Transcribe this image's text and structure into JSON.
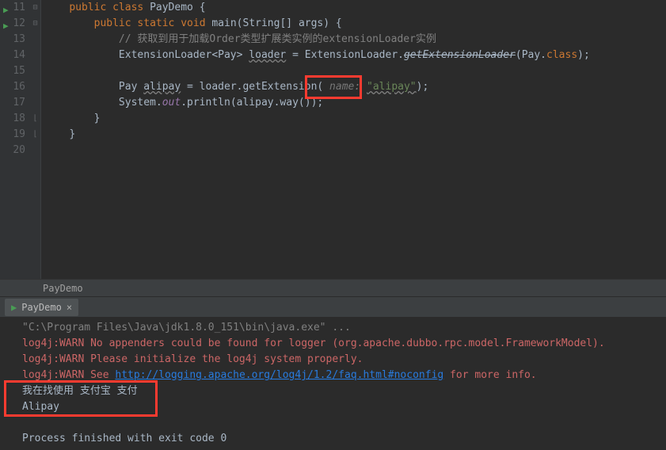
{
  "gutter": {
    "start": 11,
    "end": 20,
    "runLines": [
      11,
      12
    ]
  },
  "code": {
    "l11": {
      "indent": "    ",
      "kw_public": "public",
      "kw_class": "class",
      "name": " PayDemo ",
      "brace": "{"
    },
    "l12": {
      "indent": "        ",
      "kw_public": "public",
      "kw_static": " static",
      "kw_void": " void",
      "method": " main",
      "params": "(String[] args) {"
    },
    "l13": {
      "indent": "            ",
      "comment": "// 获取到用于加载Order类型扩展类实例的extensionLoader实例"
    },
    "l14": {
      "indent": "            ",
      "type": "ExtensionLoader<Pay> ",
      "var": "loader",
      "eq": " = ExtensionLoader.",
      "strike": "getExtensionLoader",
      "after": "(Pay.",
      "kw_class": "class",
      "end": ");"
    },
    "l15": "",
    "l16": {
      "indent": "            ",
      "type": "Pay ",
      "var": "alipay",
      "eq": " = loader.getExtension( ",
      "hint": "name: ",
      "str": "\"alipay\"",
      "end": ");"
    },
    "l17": {
      "indent": "            ",
      "sys": "System.",
      "fld": "out",
      "call": ".println(alipay.way());"
    },
    "l18": {
      "indent": "        ",
      "brace": "}"
    },
    "l19": {
      "indent": "    ",
      "brace": "}"
    }
  },
  "breadcrumb": "PayDemo",
  "consoleTab": {
    "label": "PayDemo"
  },
  "console": {
    "l1": "\"C:\\Program Files\\Java\\jdk1.8.0_151\\bin\\java.exe\" ...",
    "l2": "log4j:WARN No appenders could be found for logger (org.apache.dubbo.rpc.model.FrameworkModel).",
    "l3": "log4j:WARN Please initialize the log4j system properly.",
    "l4a": "log4j:WARN See ",
    "l4link": "http://logging.apache.org/log4j/1.2/faq.html#noconfig",
    "l4b": " for more info.",
    "l5": "我在找使用 支付宝 支付",
    "l6": "Alipay",
    "l7": "",
    "l8": "Process finished with exit code 0"
  }
}
